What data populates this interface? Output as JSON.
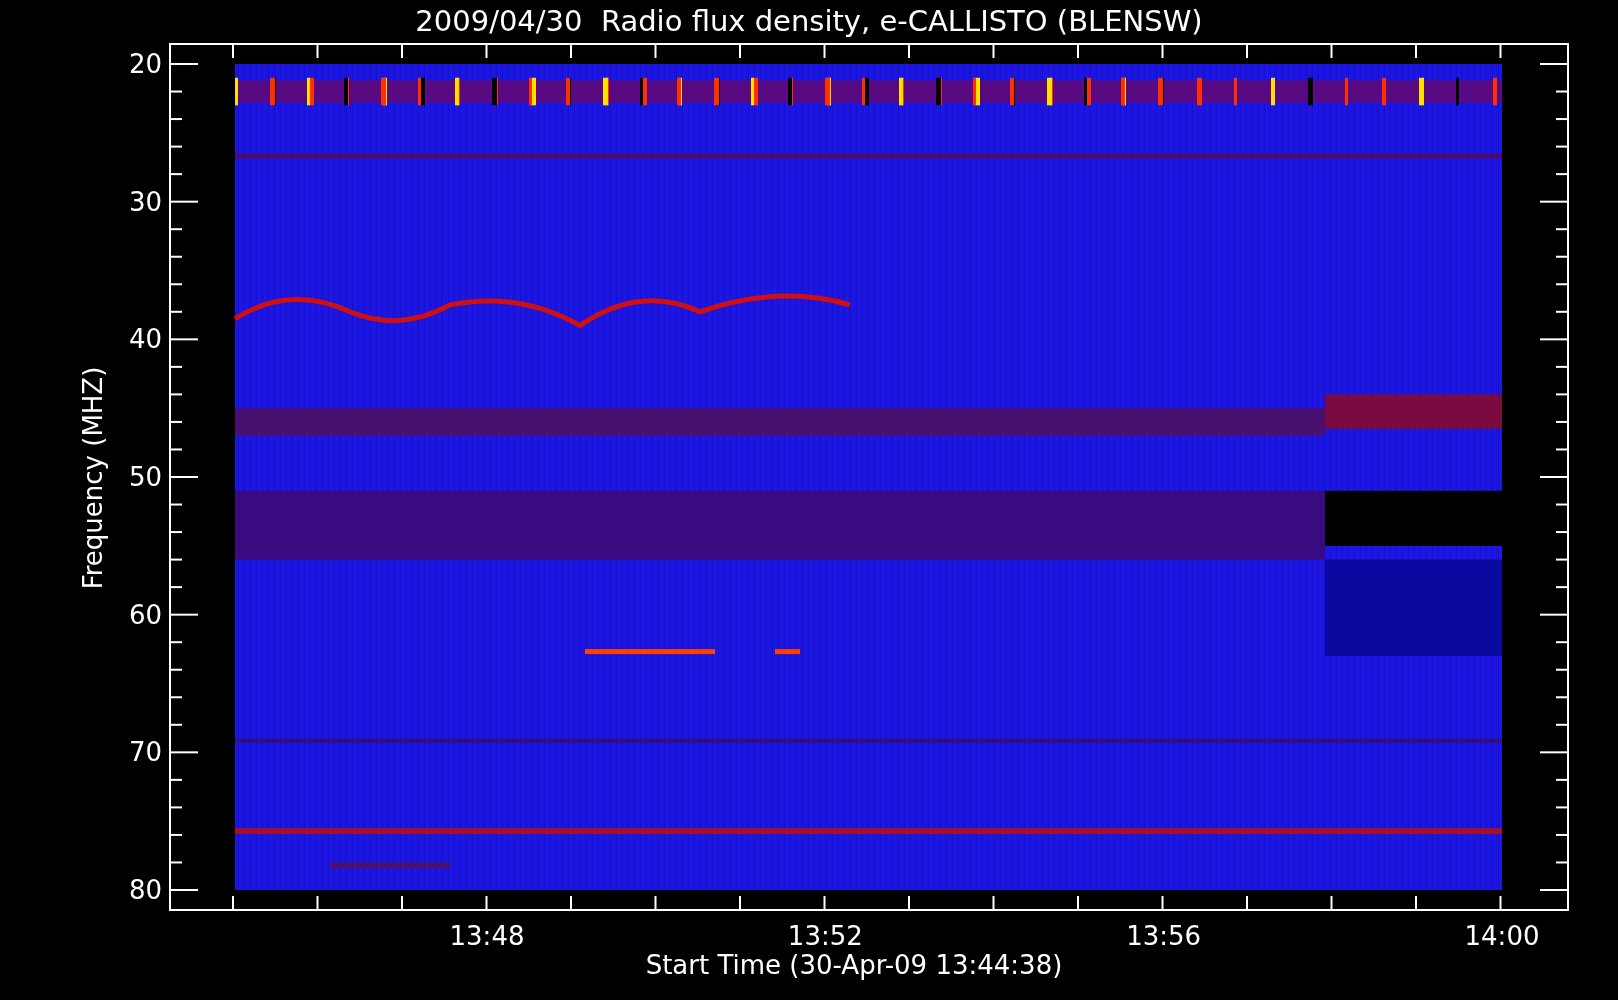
{
  "title": "2009/04/30  Radio flux density, e-CALLISTO (BLENSW)",
  "plot": {
    "ylabel": "Frequency (MHZ)",
    "xlabel": "Start Time (30-Apr-09 13:44:38)",
    "yticks": [
      "20",
      "30",
      "40",
      "50",
      "60",
      "70",
      "80"
    ],
    "xticks": [
      "13:48",
      "13:52",
      "13:56",
      "14:00"
    ]
  }
}
